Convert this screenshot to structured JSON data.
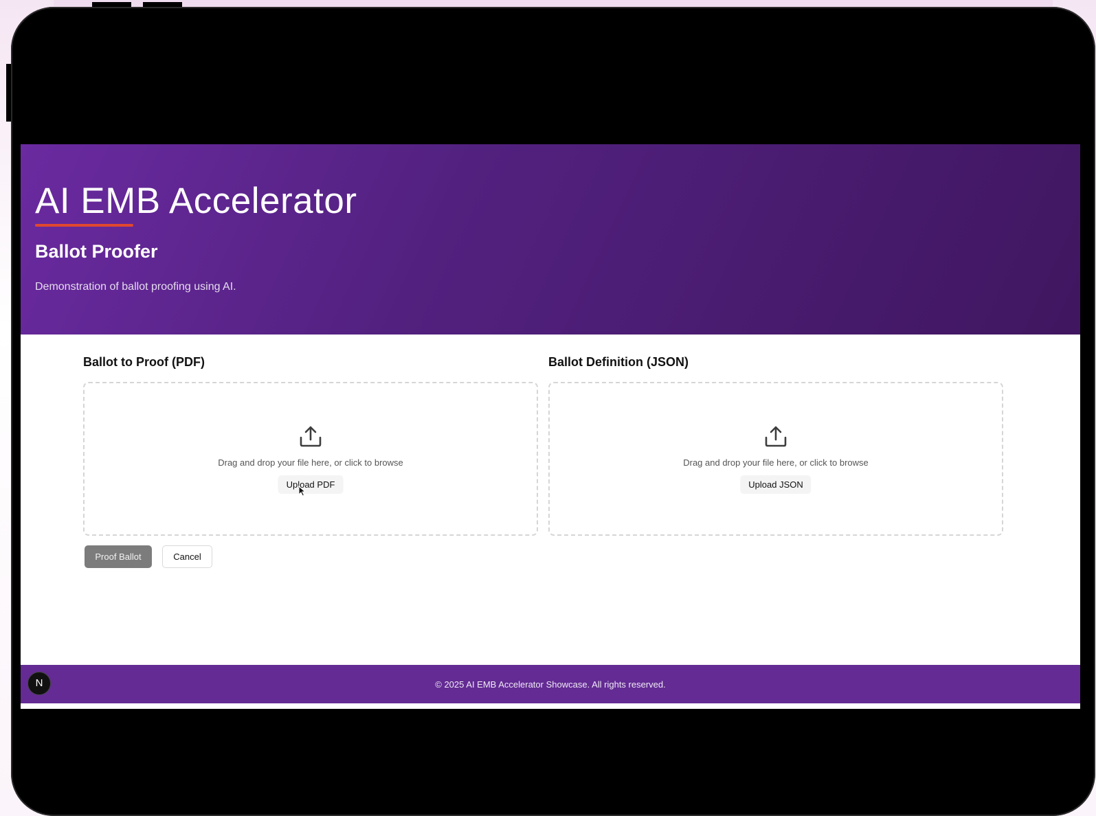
{
  "hero": {
    "title": "AI EMB Accelerator",
    "subtitle": "Ballot Proofer",
    "description": "Demonstration of ballot proofing using AI."
  },
  "uploads": {
    "pdf": {
      "label": "Ballot to Proof (PDF)",
      "drop_text": "Drag and drop your file here, or click to browse",
      "button_label": "Upload PDF",
      "icon": "upload-icon"
    },
    "json": {
      "label": "Ballot Definition (JSON)",
      "drop_text": "Drag and drop your file here, or click to browse",
      "button_label": "Upload JSON",
      "icon": "upload-icon"
    }
  },
  "actions": {
    "proof_label": "Proof Ballot",
    "cancel_label": "Cancel"
  },
  "footer": {
    "text": "© 2025 AI EMB Accelerator Showcase. All rights reserved."
  },
  "badge": {
    "letter": "N"
  },
  "colors": {
    "hero_start": "#6a2aa0",
    "hero_end": "#401660",
    "accent_underline": "#e0482f",
    "footer": "#632b93",
    "proof_button": "#7c7c7c"
  }
}
